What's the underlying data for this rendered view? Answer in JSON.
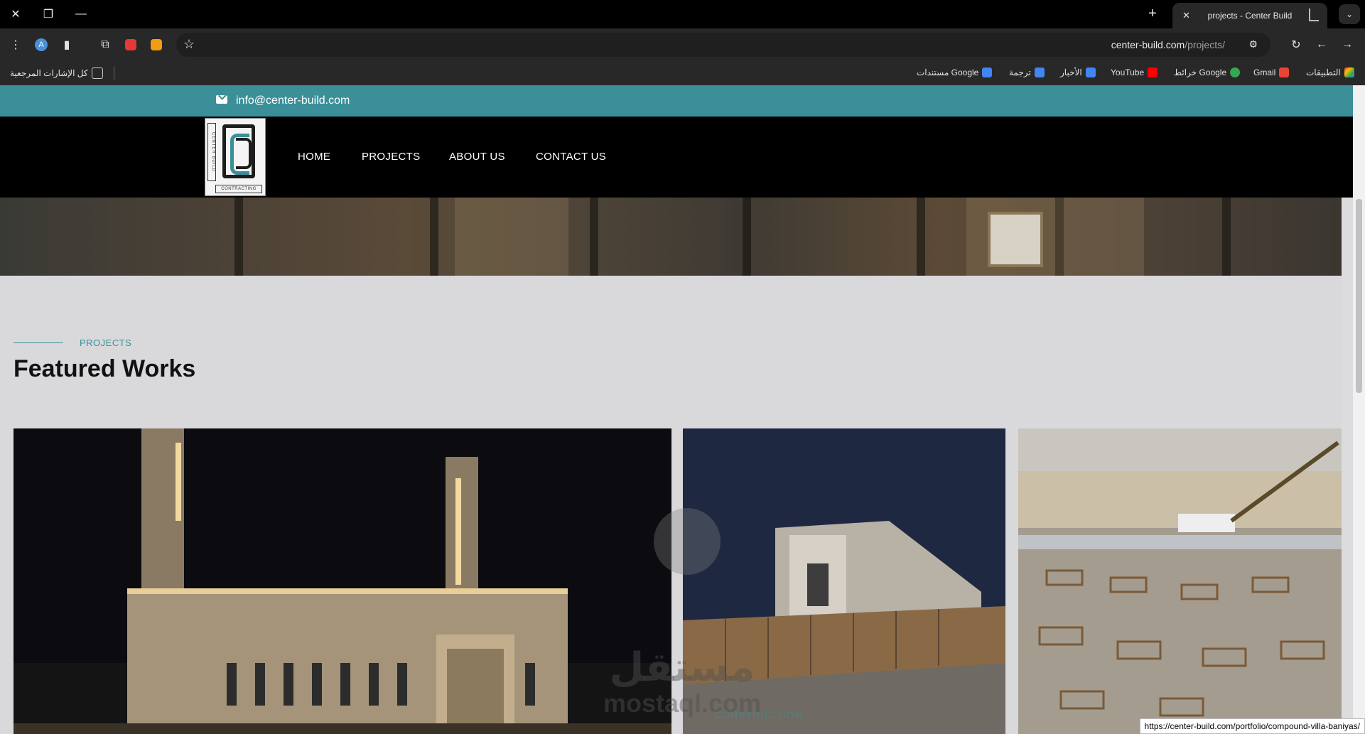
{
  "browser": {
    "tab_title": "projects - Center Build",
    "url_domain": "center-build.com",
    "url_path": "/projects/",
    "window_controls": [
      "close-icon",
      "restore-icon",
      "minimize-icon"
    ],
    "bookmarks": [
      {
        "label": "التطبيقات",
        "icon": "apps-grid-icon",
        "color": "#e94235"
      },
      {
        "label": "Gmail",
        "icon": "gmail-icon",
        "color": "#ea4335"
      },
      {
        "label": "خرائط Google",
        "icon": "maps-icon",
        "color": "#34a853"
      },
      {
        "label": "YouTube",
        "icon": "youtube-icon",
        "color": "#ff0000"
      },
      {
        "label": "الأخبار",
        "icon": "news-icon",
        "color": "#4285f4"
      },
      {
        "label": "ترجمة",
        "icon": "translate-icon",
        "color": "#4285f4"
      },
      {
        "label": "مستندات Google",
        "icon": "docs-icon",
        "color": "#4285f4"
      }
    ],
    "all_bookmarks_label": "كل الإشارات المرجعية",
    "status_url": "https://center-build.com/portfolio/compound-villa-baniyas/"
  },
  "site": {
    "topbar_email": "info@center-build.com",
    "logo_side_text": "CENTER BUILD",
    "logo_bottom_text": "CONTRACTING",
    "nav": [
      "HOME",
      "PROJECTS",
      "ABOUT US",
      "CONTACT US"
    ],
    "section_eyebrow": "PROJECTS",
    "section_title": "Featured Works",
    "card_overlay_label": "CONSTRUCTION",
    "watermark_ar": "مستقل",
    "watermark_en": "mostaql.com"
  },
  "colors": {
    "accent": "#3b8f99",
    "nav_bg": "#000000",
    "section_bg": "#d9d9dc"
  }
}
